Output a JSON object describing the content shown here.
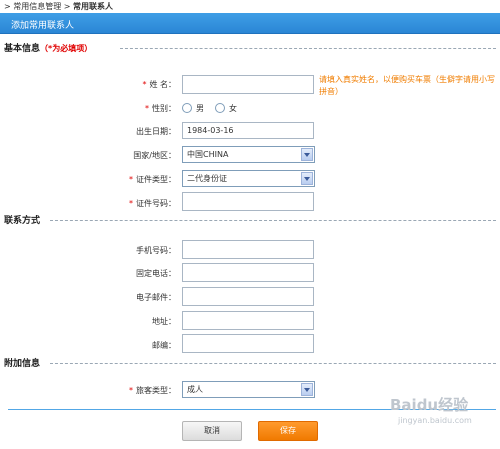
{
  "breadcrumb": {
    "parent": "常用信息管理",
    "current": "常用联系人"
  },
  "header": {
    "title": "添加常用联系人"
  },
  "basic": {
    "title": "基本信息",
    "required_note": "（*为必填项）",
    "name": {
      "label": "姓 名：",
      "value": "",
      "hint": "请填入真实姓名，以便购买车票（生僻字请用小写拼音）"
    },
    "gender": {
      "label": "性别：",
      "options": [
        "男",
        "女"
      ]
    },
    "birth": {
      "label": "出生日期：",
      "value": "1984-03-16"
    },
    "country": {
      "label": "国家/地区：",
      "value": "中国CHINA"
    },
    "id_type": {
      "label": "证件类型：",
      "value": "二代身份证"
    },
    "id_no": {
      "label": "证件号码：",
      "value": ""
    }
  },
  "contact": {
    "title": "联系方式",
    "mobile": {
      "label": "手机号码：",
      "value": ""
    },
    "phone": {
      "label": "固定电话：",
      "value": ""
    },
    "email": {
      "label": "电子邮件：",
      "value": ""
    },
    "address": {
      "label": "地址：",
      "value": ""
    },
    "zip": {
      "label": "邮编：",
      "value": ""
    }
  },
  "extra": {
    "title": "附加信息",
    "passenger_type": {
      "label": "旅客类型：",
      "value": "成人"
    }
  },
  "buttons": {
    "cancel": "取消",
    "save": "保存"
  },
  "watermark": {
    "line1": "Baidu经验",
    "line2": "jingyan.baidu.com"
  },
  "colors": {
    "header": "#2b86d5",
    "required": "#e00000",
    "hint": "#f07d00",
    "save": "#f07a00"
  }
}
